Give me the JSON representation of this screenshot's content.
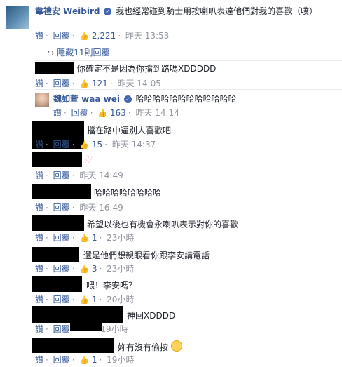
{
  "top_comment": {
    "author": "韋禮安 Weibird",
    "text": "我也經常碰到騎士用按喇叭表達他們對我的喜歡（噗）",
    "read": "讚",
    "reply": "回覆",
    "likes": "2,221",
    "time": "昨天 13:53"
  },
  "hidden_replies": "隱藏11則回覆",
  "replies": [
    {
      "text": "你確定不是因為你擋到路嗎XDDDDD",
      "likes": "121",
      "time": "昨天 14:05"
    },
    {
      "author": "魏如萱 waa wei",
      "text": "哈哈哈哈哈哈哈哈哈哈哈哈",
      "likes": "163",
      "time": "昨天 14:14"
    },
    {
      "text": "擋在路中逼別人喜歡吧",
      "likes": "15",
      "time": "昨天 14:37"
    },
    {
      "text": "",
      "likes": "",
      "time": "昨天 14:49"
    },
    {
      "text": "哈哈哈哈哈哈哈哈",
      "likes": "",
      "time": "昨天 16:49"
    },
    {
      "text": "希望以後也有機會永喇叭表示對你的喜歡",
      "likes": "1",
      "time": "23小時"
    },
    {
      "text": "還是他們想親眼看你跟李安講電話",
      "likes": "3",
      "time": "23小時"
    },
    {
      "text": "喂！李安嗎？",
      "likes": "1",
      "time": "20小時"
    },
    {
      "text": "神回XDDDD",
      "likes": "",
      "time": "19小時"
    },
    {
      "text": "妳有沒有偷按",
      "likes": "1",
      "time": "19小時"
    }
  ],
  "labels": {
    "like": "讚",
    "reply": "回覆"
  },
  "icons": {
    "like": "thumbs-up-icon",
    "verified": "verified-badge-icon",
    "heart": "heart-icon",
    "emoji": "smile-emoji-icon",
    "arrow": "reply-arrow-icon"
  }
}
